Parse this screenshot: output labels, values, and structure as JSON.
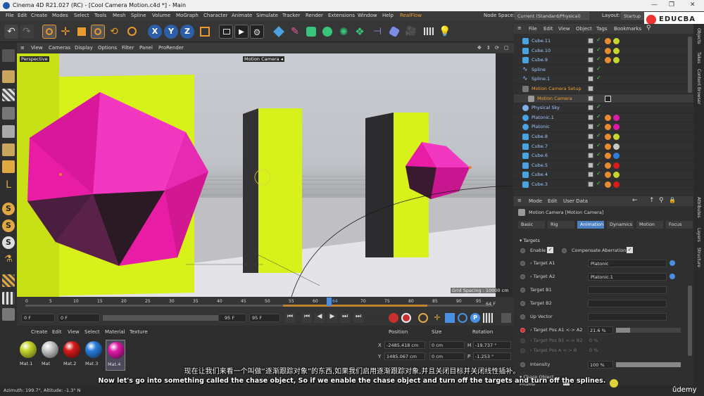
{
  "window": {
    "title": "Cinema 4D R21.027 (RC) - [Cool Camera Motion.c4d *] - Main",
    "controls": [
      "—",
      "❐",
      "✕"
    ]
  },
  "menubar": {
    "items": [
      "File",
      "Edit",
      "Create",
      "Modes",
      "Select",
      "Tools",
      "Mesh",
      "Spline",
      "Volume",
      "MoGraph",
      "Character",
      "Animate",
      "Simulate",
      "Tracker",
      "Render",
      "Extensions",
      "Window",
      "Help",
      "RealFlow"
    ],
    "node_space_label": "Node Space:",
    "node_space_value": "Current (Standard/Physical)",
    "layout_label": "Layout:",
    "layout_value": "Startup"
  },
  "toolbar": {
    "axis_labels": [
      "X",
      "Y",
      "Z"
    ]
  },
  "viewport": {
    "menu": [
      "View",
      "Cameras",
      "Display",
      "Options",
      "Filter",
      "Panel",
      "ProRender"
    ],
    "name": "Perspective",
    "camera_label": "Motion Camera",
    "grid_spacing": "Grid Spacing : 10000 cm"
  },
  "timeline": {
    "ticks": [
      "0",
      "5",
      "10",
      "15",
      "20",
      "25",
      "30",
      "35",
      "40",
      "45",
      "50",
      "55",
      "60",
      "64",
      "70",
      "75",
      "80",
      "85",
      "90",
      "95"
    ],
    "current_frame": "64 F"
  },
  "transport": {
    "start": "0 F",
    "field2": "0 F",
    "end": "95 F",
    "end2": "95 F"
  },
  "material_panel": {
    "menu": [
      "Create",
      "Edit",
      "View",
      "Select",
      "Material",
      "Texture"
    ],
    "materials": [
      {
        "name": "Mat.1",
        "color": "#c6d62b"
      },
      {
        "name": "Mat",
        "color": "#c8c8c8"
      },
      {
        "name": "Mat.2",
        "color": "#d81b1b"
      },
      {
        "name": "Mat.3",
        "color": "#2b7fdd"
      },
      {
        "name": "Mat.4",
        "color": "#e01aa8"
      }
    ]
  },
  "coord_panel": {
    "headers": [
      "Position",
      "Size",
      "Rotation"
    ],
    "rows": [
      {
        "axis": "X",
        "pos": "-2485.418 cm",
        "size": "0 cm",
        "raxis": "H",
        "rot": "-19.737 °"
      },
      {
        "axis": "Y",
        "pos": "1485.067 cm",
        "size": "0 cm",
        "raxis": "P",
        "rot": "-1.253 °"
      }
    ]
  },
  "statusbar": {
    "text": "Azimuth: 199.7°, Altitude: -1.3°  N"
  },
  "object_manager": {
    "menu": [
      "File",
      "Edit",
      "View",
      "Object",
      "Tags",
      "Bookmarks"
    ],
    "objects": [
      {
        "name": "Cube.11",
        "icon": "cube-icon",
        "tag": "#c6d62b"
      },
      {
        "name": "Cube.10",
        "icon": "cube-icon",
        "tag": "#c6d62b"
      },
      {
        "name": "Cube.9",
        "icon": "cube-icon",
        "tag": "#c6d62b"
      },
      {
        "name": "Spline",
        "icon": "spline-icon",
        "tag": ""
      },
      {
        "name": "Spline.1",
        "icon": "spline-icon",
        "tag": ""
      },
      {
        "name": "Motion Camera Setup",
        "icon": "camera-rig-icon",
        "tag": ""
      },
      {
        "name": "Motion Camera",
        "icon": "camera-icon",
        "tag": ""
      },
      {
        "name": "Physical Sky",
        "icon": "sky-icon",
        "tag": ""
      },
      {
        "name": "Platonic.1",
        "icon": "platonic-icon",
        "tag": "#e01aa8"
      },
      {
        "name": "Platonic",
        "icon": "platonic-icon",
        "tag": "#e01aa8"
      },
      {
        "name": "Cube.8",
        "icon": "cube-icon",
        "tag": "#c6d62b"
      },
      {
        "name": "Cube.7",
        "icon": "cube-icon",
        "tag": "#c8c8c8"
      },
      {
        "name": "Cube.6",
        "icon": "cube-icon",
        "tag": "#2b7fdd"
      },
      {
        "name": "Cube.5",
        "icon": "cube-icon",
        "tag": "#d81b1b"
      },
      {
        "name": "Cube.4",
        "icon": "cube-icon",
        "tag": "#c6d62b"
      },
      {
        "name": "Cube.3",
        "icon": "cube-icon",
        "tag": "#d81b1b"
      }
    ]
  },
  "attribute_manager": {
    "menu": [
      "Mode",
      "Edit",
      "User Data"
    ],
    "object_title": "Motion Camera [Motion Camera]",
    "tabs": [
      "Basic",
      "Rig",
      "Animation",
      "Dynamics",
      "Motion",
      "Focus"
    ],
    "active_tab": "Animation",
    "section": "Targets",
    "enable_label": "Enable",
    "compensate_label": "Compensate Aberration",
    "fields": [
      {
        "label": "Target A1",
        "value": "Platonic"
      },
      {
        "label": "Target A2",
        "value": "Platonic.1"
      },
      {
        "label": "Target B1",
        "value": ""
      },
      {
        "label": "Target B2",
        "value": ""
      },
      {
        "label": "Up Vector",
        "value": ""
      }
    ],
    "target_pos_label": "Target Pos A1 <-> A2",
    "target_pos_value": "21.6 %",
    "dim_rows": [
      "Target Pos B1 <-> B2",
      "Target Pos A <-> B"
    ],
    "dim_values": [
      "0 %",
      "0 %"
    ],
    "intensity_label": "Intensity",
    "intensity_value": "100 %",
    "chase_label": "Chase Object",
    "chase_enable": "Enable"
  },
  "right_strip": [
    "Objects",
    "Takes",
    "Content Browser",
    "Attributes",
    "Layers",
    "Structure"
  ],
  "brand": "EDUCBA",
  "watermark": "ûdemy",
  "subtitles": {
    "chinese": "现在让我们来看一个叫做“逐渐跟踪对象”的东西,如果我们启用逐渐跟踪对象,并且关闭目标并关闭线性插补。",
    "english": "Now let's go into something called the chase object, So if we enable the chase object and turn off the targets and turn off the splines."
  },
  "colors": {
    "accent": "#4a90e2",
    "magenta": "#e01aa8",
    "lime": "#d7f21a"
  }
}
